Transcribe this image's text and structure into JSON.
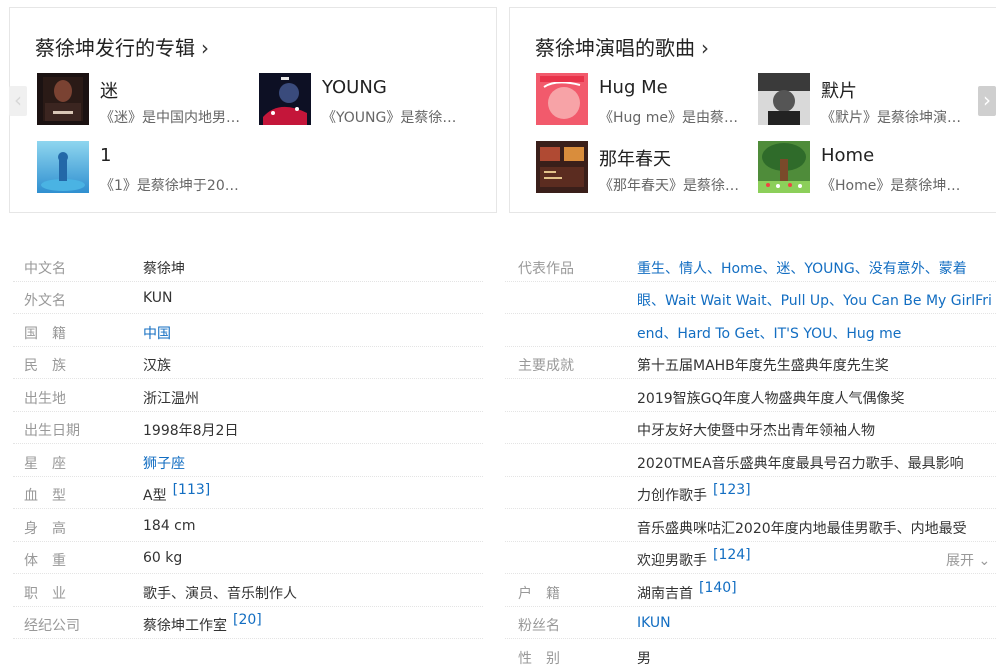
{
  "albums": {
    "title": "蔡徐坤发行的专辑",
    "items": [
      {
        "title": "迷",
        "desc": "《迷》是中国内地男…"
      },
      {
        "title": "YOUNG",
        "desc": "《YOUNG》是蔡徐…"
      },
      {
        "title": "1",
        "desc": "《1》是蔡徐坤于20…"
      }
    ]
  },
  "songs": {
    "title": "蔡徐坤演唱的歌曲",
    "items": [
      {
        "title": "Hug Me",
        "desc": "《Hug me》是由蔡…"
      },
      {
        "title": "默片",
        "desc": "《默片》是蔡徐坤演…"
      },
      {
        "title": "那年春天",
        "desc": "《那年春天》是蔡徐…"
      },
      {
        "title": "Home",
        "desc": "《Home》是蔡徐坤…"
      }
    ]
  },
  "arrows": {
    "left": "‹",
    "right": "›"
  },
  "left_info": [
    {
      "label": "中文名",
      "value": "蔡徐坤"
    },
    {
      "label": "外文名",
      "value": "KUN"
    },
    {
      "label": "国　籍",
      "value": "中国"
    },
    {
      "label": "民　族",
      "value": "汉族"
    },
    {
      "label": "出生地",
      "value": "浙江温州"
    },
    {
      "label": "出生日期",
      "value": "1998年8月2日"
    },
    {
      "label": "星　座",
      "value": "狮子座"
    },
    {
      "label": "血　型",
      "value": "A型",
      "ref": "[113]"
    },
    {
      "label": "身　高",
      "value": "184 cm"
    },
    {
      "label": "体　重",
      "value": "60 kg"
    },
    {
      "label": "职　业",
      "value": "歌手、演员、音乐制作人"
    },
    {
      "label": "经纪公司",
      "value": "蔡徐坤工作室",
      "ref": "[20]"
    }
  ],
  "right_info": {
    "works_label": "代表作品",
    "works_lines": [
      "重生、情人、Home、迷、YOUNG、没有意外、蒙着",
      "眼、Wait Wait Wait、Pull Up、You Can Be My GirlFri",
      "end、Hard To Get、IT'S YOU、Hug me"
    ],
    "achieve_label": "主要成就",
    "achieve_lines": [
      "第十五届MAHB年度先生盛典年度先生奖",
      "2019智族GQ年度人物盛典年度人气偶像奖",
      "中牙友好大使暨中牙杰出青年领袖人物",
      "2020TMEA音乐盛典年度最具号召力歌手、最具影响",
      "力创作歌手",
      "音乐盛典咪咕汇2020年度内地最佳男歌手、内地最受",
      "欢迎男歌手"
    ],
    "achieve_ref_1": "[123]",
    "achieve_ref_2": "[124]",
    "expand_label": "展开",
    "expand_icon": "⌄",
    "huji_label": "户　籍",
    "huji_value": "湖南吉首",
    "huji_ref": "[140]",
    "fans_label": "粉丝名",
    "fans_value": "IKUN",
    "gender_label": "性　别",
    "gender_value": "男"
  }
}
